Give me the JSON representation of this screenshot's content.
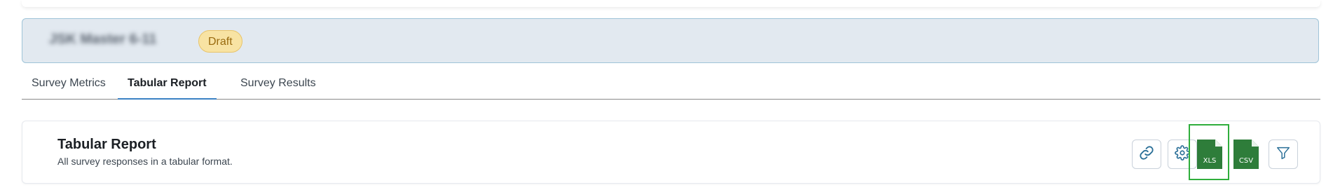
{
  "survey": {
    "title": "JSK Master 6-11",
    "status": "Draft"
  },
  "tabs": [
    {
      "label": "Survey Metrics",
      "active": false
    },
    {
      "label": "Tabular Report",
      "active": true
    },
    {
      "label": "Survey Results",
      "active": false
    }
  ],
  "report": {
    "title": "Tabular Report",
    "subtitle": "All survey responses in a tabular format."
  },
  "actions": {
    "link_icon": "link-icon",
    "settings_icon": "gear-icon",
    "xls_label": "XLS",
    "csv_label": "CSV",
    "filter_icon": "filter-icon"
  },
  "colors": {
    "header_bg": "#e2e9f0",
    "badge_bg": "#f8e3a3",
    "active_tab_underline": "#3b82c4",
    "file_green": "#2e7d3a",
    "selection_outline": "#2fae3c",
    "icon_blue": "#2a6f97"
  }
}
